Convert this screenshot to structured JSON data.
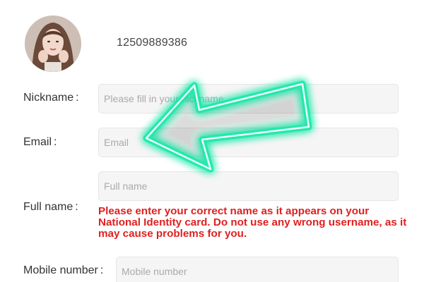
{
  "profile": {
    "phone": "12509889386"
  },
  "form": {
    "nickname": {
      "label": "Nickname",
      "separator": ":",
      "placeholder": "Please fill in your nickname",
      "value": ""
    },
    "email": {
      "label": "Email",
      "separator": ":",
      "placeholder": "Email",
      "value": ""
    },
    "fullname": {
      "label": "Full name",
      "separator": ":",
      "placeholder": "Full name",
      "value": ""
    },
    "mobile": {
      "label": "Mobile number",
      "separator": ":",
      "placeholder": "Mobile number",
      "value": ""
    },
    "warning": "Please enter your correct name as it appears on your National Identity card. Do not use any wrong username, as it may cause problems for you."
  },
  "colors": {
    "warning": "#e02020",
    "arrow_glow": "#00e6a0",
    "input_bg": "#f5f5f5"
  },
  "icons": {
    "overlay": "left-arrow-icon"
  }
}
